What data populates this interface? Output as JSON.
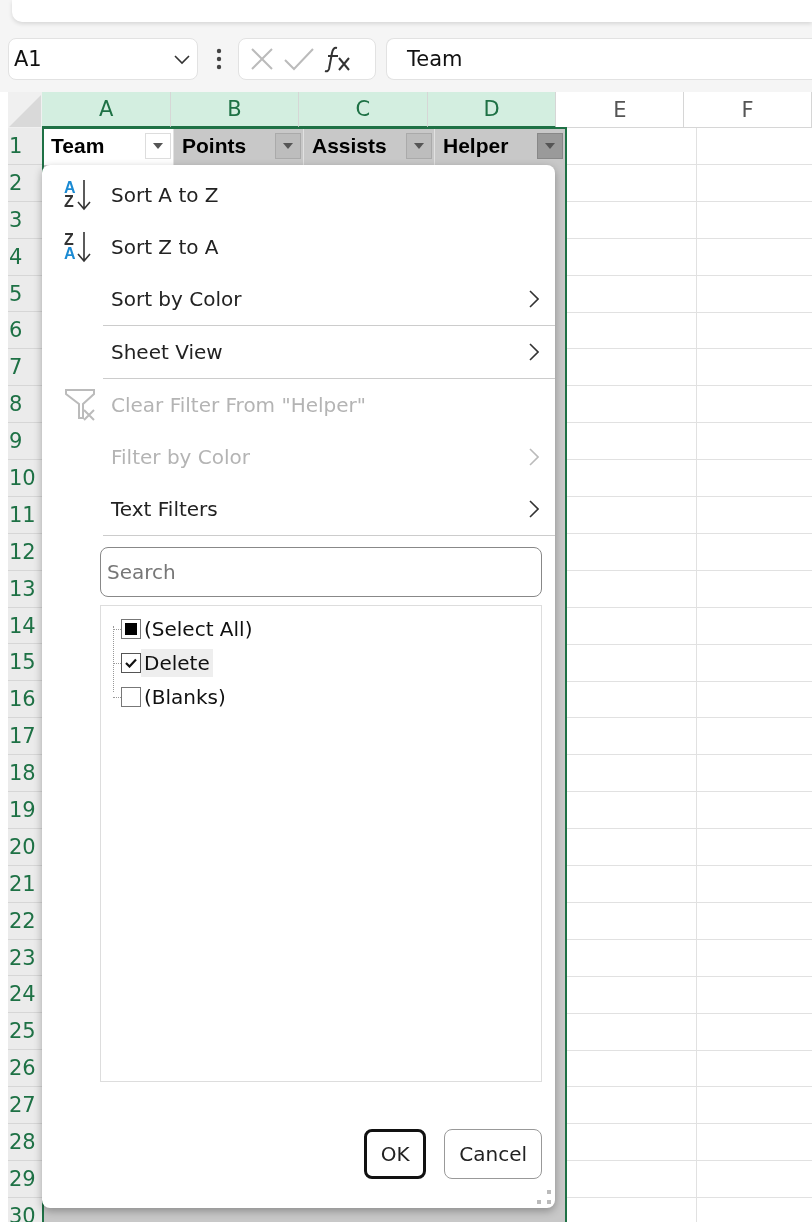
{
  "formula_bar": {
    "name_box": "A1",
    "formula": "Team"
  },
  "columns": [
    {
      "letter": "A",
      "selected": true
    },
    {
      "letter": "B",
      "selected": true
    },
    {
      "letter": "C",
      "selected": true
    },
    {
      "letter": "D",
      "selected": true
    },
    {
      "letter": "E",
      "selected": false
    },
    {
      "letter": "F",
      "selected": false
    }
  ],
  "rows": [
    "1",
    "2",
    "3",
    "4",
    "5",
    "6",
    "7",
    "8",
    "9",
    "10",
    "11",
    "12",
    "13",
    "14",
    "15",
    "16",
    "17",
    "18",
    "19",
    "20",
    "21",
    "22",
    "23",
    "24",
    "25",
    "26",
    "27",
    "28",
    "29",
    "30"
  ],
  "header_cells": [
    {
      "text": "Team",
      "filter_open": false,
      "active": true
    },
    {
      "text": "Points",
      "filter_open": false,
      "active": false
    },
    {
      "text": "Assists",
      "filter_open": false,
      "active": false
    },
    {
      "text": "Helper",
      "filter_open": true,
      "active": false
    }
  ],
  "filter_menu": {
    "items": [
      {
        "kind": "sort_ascending",
        "label": "Sort A to Z",
        "icon_top": "A",
        "icon_bottom": "Z",
        "submenu": false,
        "disabled": false,
        "divider_after": false
      },
      {
        "kind": "sort_descending",
        "label": "Sort Z to A",
        "icon_top": "Z",
        "icon_bottom": "A",
        "submenu": false,
        "disabled": false,
        "divider_after": false
      },
      {
        "kind": "plain",
        "label": "Sort by Color",
        "submenu": true,
        "disabled": false,
        "divider_after": true
      },
      {
        "kind": "plain",
        "label": "Sheet View",
        "submenu": true,
        "disabled": false,
        "divider_after": true
      },
      {
        "kind": "clear_filter",
        "label": "Clear Filter From \"Helper\"",
        "submenu": false,
        "disabled": true,
        "divider_after": false
      },
      {
        "kind": "plain",
        "label": "Filter by Color",
        "submenu": true,
        "disabled": true,
        "divider_after": false
      },
      {
        "kind": "plain",
        "label": "Text Filters",
        "submenu": true,
        "disabled": false,
        "divider_after": true
      }
    ],
    "search": {
      "placeholder": "Search"
    },
    "values": [
      {
        "label": "(Select All)",
        "checked": false,
        "partial": true,
        "selected": false
      },
      {
        "label": "Delete",
        "checked": true,
        "partial": false,
        "selected": true
      },
      {
        "label": "(Blanks)",
        "checked": false,
        "partial": false,
        "selected": false
      }
    ],
    "buttons": [
      {
        "label": "OK",
        "default": true
      },
      {
        "label": "Cancel",
        "default": false
      }
    ]
  }
}
